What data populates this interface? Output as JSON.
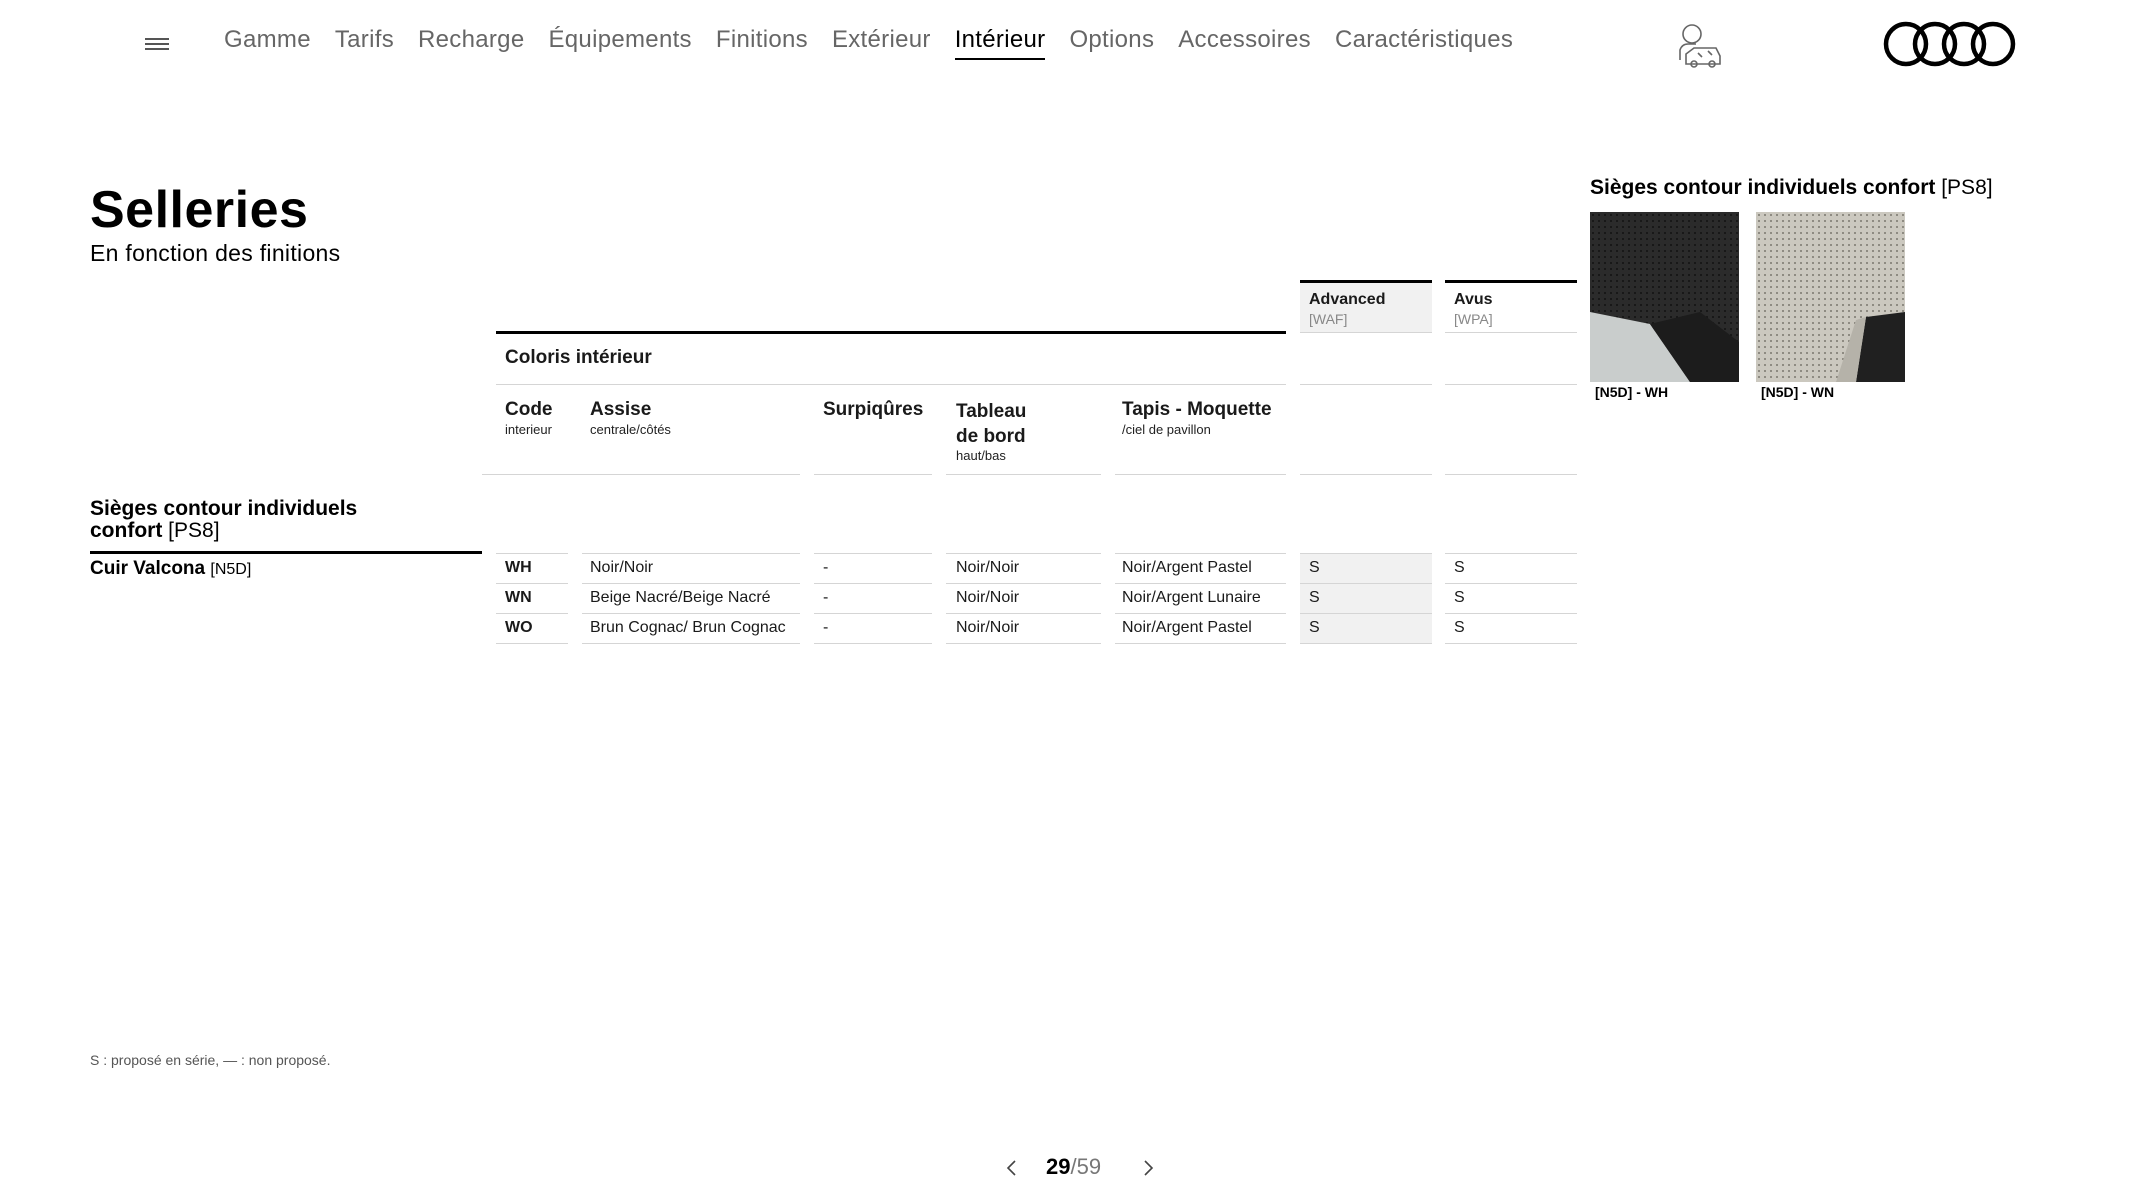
{
  "nav": {
    "items": [
      "Gamme",
      "Tarifs",
      "Recharge",
      "Équipements",
      "Finitions",
      "Extérieur",
      "Intérieur",
      "Options",
      "Accessoires",
      "Caractéristiques"
    ],
    "active": "Intérieur"
  },
  "page": {
    "title": "Selleries",
    "subtitle": "En fonction des finitions"
  },
  "table": {
    "section_header": "Coloris intérieur",
    "columns": {
      "code": {
        "label": "Code",
        "sub": "interieur"
      },
      "assise": {
        "label": "Assise",
        "sub": "centrale/côtés"
      },
      "surpiqures": {
        "label": "Surpiqûres",
        "sub": ""
      },
      "tableau": {
        "label": "Tableau de bord",
        "label1": "Tableau",
        "label2": "de bord",
        "sub": "haut/bas"
      },
      "tapis": {
        "label": "Tapis - Moquette",
        "sub": "/ciel de pavillon"
      }
    },
    "trims": [
      {
        "name": "Advanced",
        "code": "[WAF]"
      },
      {
        "name": "Avus",
        "code": "[WPA]"
      }
    ],
    "group_title_line1": "Sièges contour individuels",
    "group_title_line2": "confort",
    "group_code": "[PS8]",
    "material": "Cuir Valcona",
    "material_code": "[N5D]",
    "rows": [
      {
        "code": "WH",
        "assise": "Noir/Noir",
        "surpiqures": "-",
        "tableau": "Noir/Noir",
        "tapis": "Noir/Argent Pastel",
        "advanced": "S",
        "avus": "S"
      },
      {
        "code": "WN",
        "assise": "Beige Nacré/Beige Nacré",
        "surpiqures": "-",
        "tableau": "Noir/Noir",
        "tapis": "Noir/Argent Lunaire",
        "advanced": "S",
        "avus": "S"
      },
      {
        "code": "WO",
        "assise": "Brun Cognac/ Brun Cognac",
        "surpiqures": "-",
        "tableau": "Noir/Noir",
        "tapis": "Noir/Argent Pastel",
        "advanced": "S",
        "avus": "S"
      }
    ]
  },
  "swatches": {
    "title": "Sièges contour individuels confort",
    "title_code": "[PS8]",
    "items": [
      {
        "caption": "[N5D] - WH",
        "color": "#2a2a2a"
      },
      {
        "caption": "[N5D] - WN",
        "color": "#c9c6bd"
      }
    ]
  },
  "footnote": "S : proposé en série, — : non proposé.",
  "pager": {
    "current": "29",
    "separator": "/",
    "total": "59"
  },
  "colors": {
    "shade": "#f1f1f1",
    "nav_inactive": "#666666",
    "accent": "#000000"
  }
}
